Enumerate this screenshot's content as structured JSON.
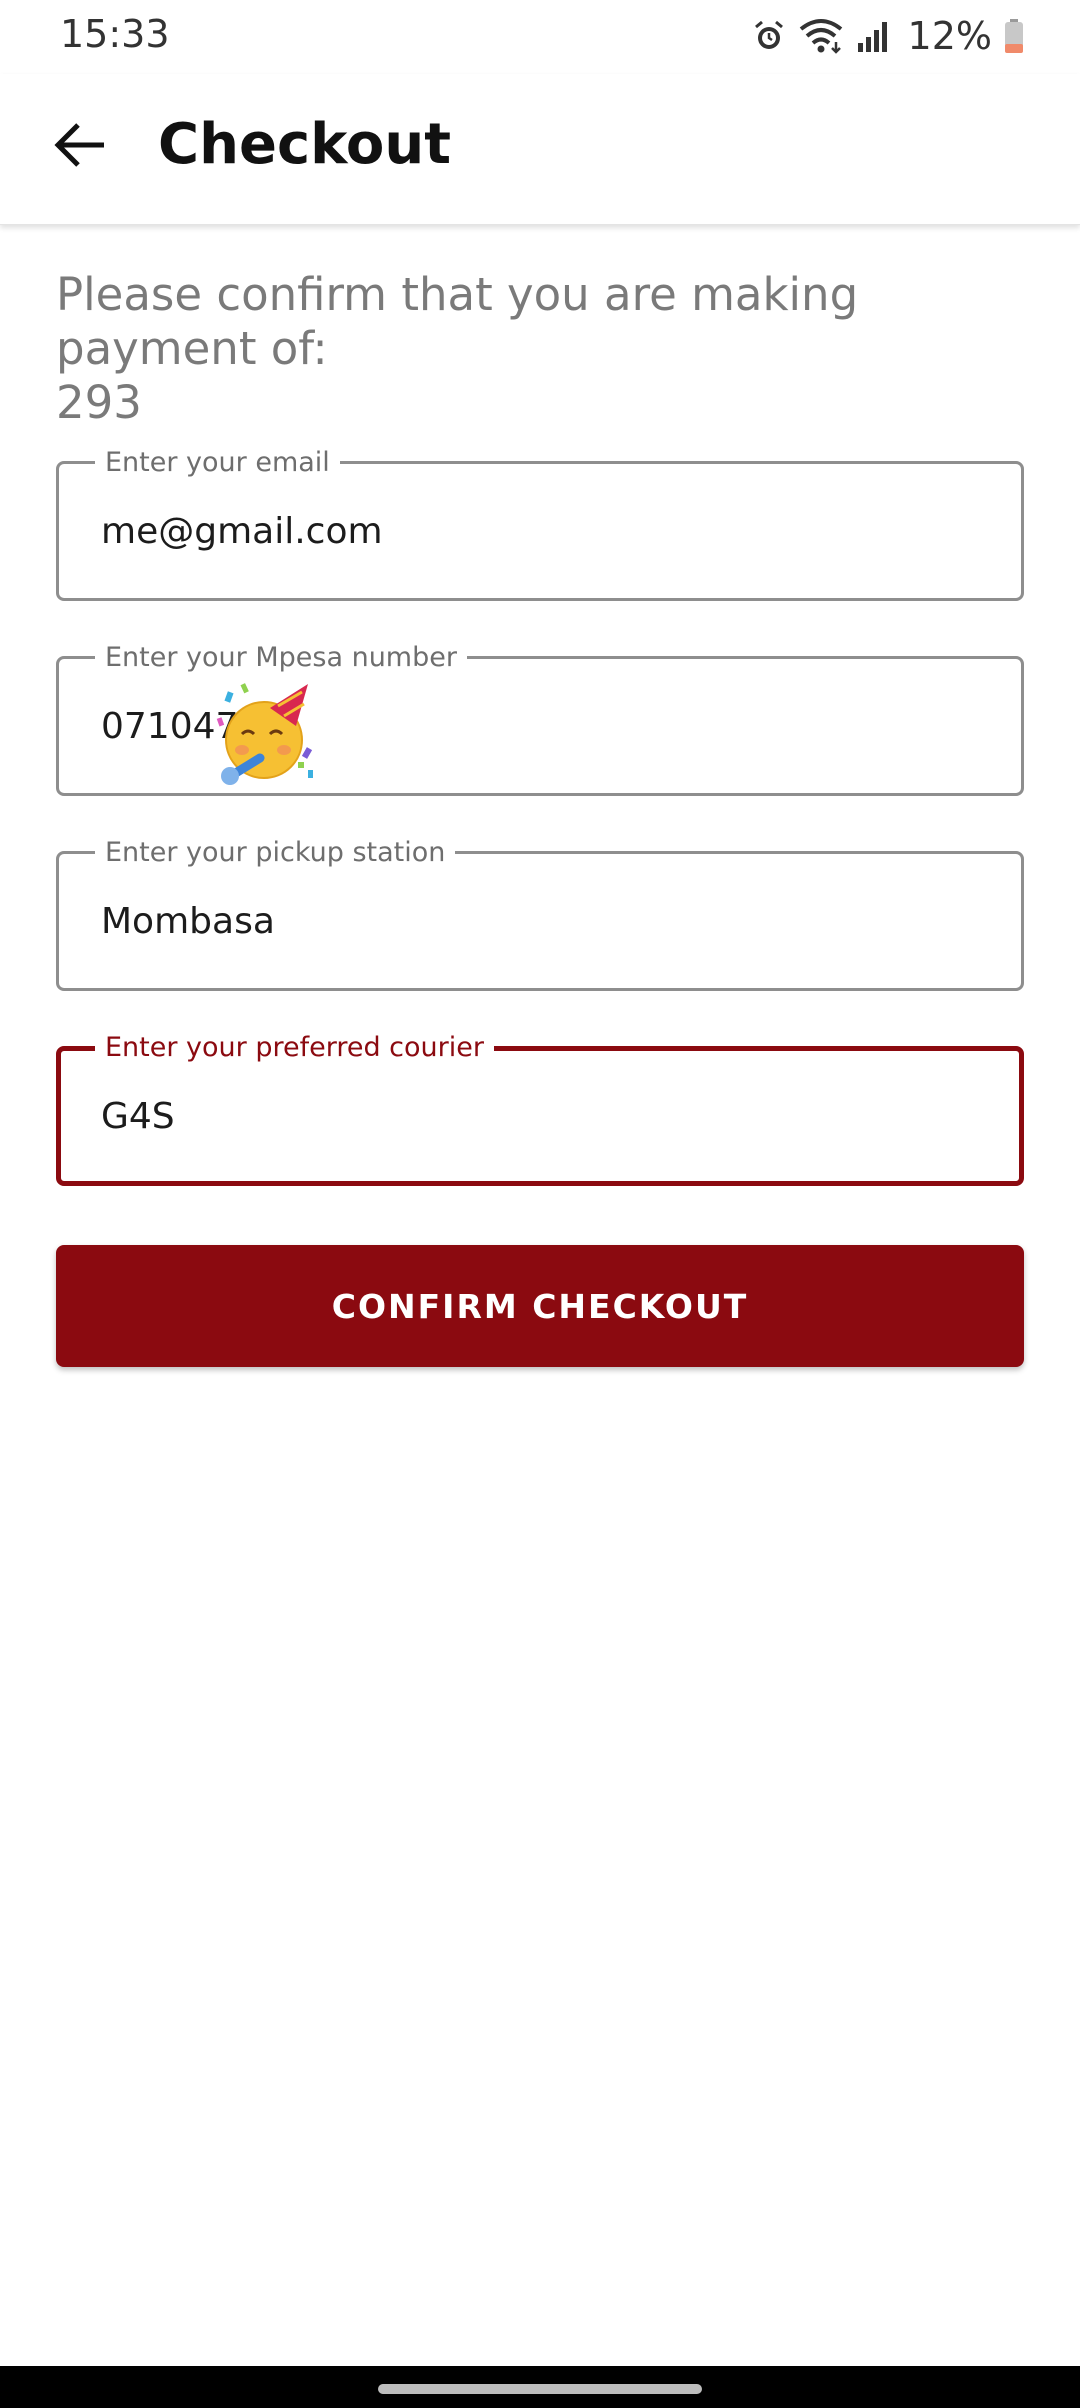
{
  "status_bar": {
    "time": "15:33",
    "battery_percent": "12%",
    "icons": [
      "alarm-icon",
      "wifi-icon",
      "signal-icon",
      "battery-icon"
    ]
  },
  "app_bar": {
    "title": "Checkout",
    "back_icon": "arrow-back-icon"
  },
  "checkout": {
    "prompt_line1": "Please confirm that you are making payment of:",
    "amount": "293",
    "fields": [
      {
        "label": "Enter your email",
        "value": "me@gmail.com"
      },
      {
        "label": "Enter your Mpesa number",
        "value": "071047"
      },
      {
        "label": "Enter your pickup station",
        "value": "Mombasa"
      },
      {
        "label": "Enter your preferred courier",
        "value": "G4S"
      }
    ],
    "confirm_label": "CONFIRM CHECKOUT"
  },
  "colors": {
    "accent": "#8b0a10",
    "field_border": "#8e8e8e",
    "prompt_text": "#7a7a7a"
  }
}
